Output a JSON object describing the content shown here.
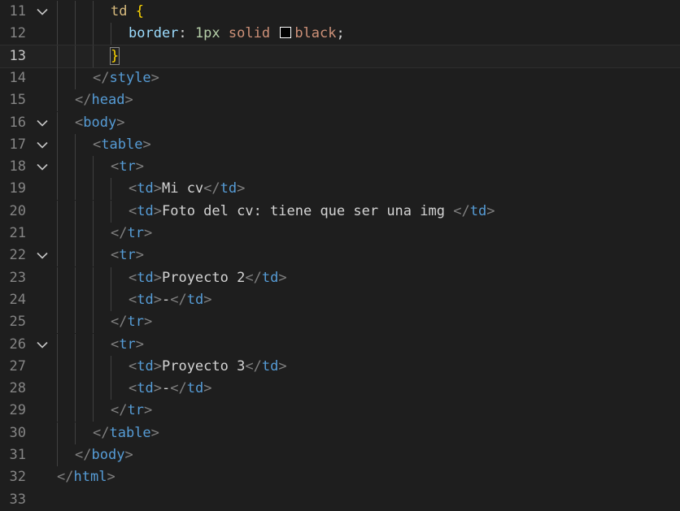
{
  "editor": {
    "language": "html",
    "active_line": 13,
    "lines": [
      {
        "n": "11",
        "fold": true,
        "indent": 3,
        "tokens": [
          [
            "sel",
            "td"
          ],
          [
            "text",
            " "
          ],
          [
            "brace",
            "{"
          ]
        ]
      },
      {
        "n": "12",
        "fold": false,
        "indent": 4,
        "tokens": [
          [
            "prop",
            "border"
          ],
          [
            "text",
            ": "
          ],
          [
            "num",
            "1px"
          ],
          [
            "text",
            " "
          ],
          [
            "val",
            "solid"
          ],
          [
            "text",
            " "
          ],
          [
            "swatch",
            ""
          ],
          [
            "val",
            "black"
          ],
          [
            "text",
            ";"
          ]
        ]
      },
      {
        "n": "13",
        "fold": false,
        "indent": 3,
        "tokens": [
          [
            "brace-hl",
            "}"
          ]
        ]
      },
      {
        "n": "14",
        "fold": false,
        "indent": 2,
        "tokens": [
          [
            "punct",
            "</"
          ],
          [
            "tag",
            "style"
          ],
          [
            "punct",
            ">"
          ]
        ]
      },
      {
        "n": "15",
        "fold": false,
        "indent": 1,
        "tokens": [
          [
            "punct",
            "</"
          ],
          [
            "tag",
            "head"
          ],
          [
            "punct",
            ">"
          ]
        ]
      },
      {
        "n": "16",
        "fold": true,
        "indent": 1,
        "tokens": [
          [
            "punct",
            "<"
          ],
          [
            "tag",
            "body"
          ],
          [
            "punct",
            ">"
          ]
        ]
      },
      {
        "n": "17",
        "fold": true,
        "indent": 2,
        "tokens": [
          [
            "punct",
            "<"
          ],
          [
            "tag",
            "table"
          ],
          [
            "punct",
            ">"
          ]
        ]
      },
      {
        "n": "18",
        "fold": true,
        "indent": 3,
        "tokens": [
          [
            "punct",
            "<"
          ],
          [
            "tag",
            "tr"
          ],
          [
            "punct",
            ">"
          ]
        ]
      },
      {
        "n": "19",
        "fold": false,
        "indent": 4,
        "tokens": [
          [
            "punct",
            "<"
          ],
          [
            "tag",
            "td"
          ],
          [
            "punct",
            ">"
          ],
          [
            "text",
            "Mi cv"
          ],
          [
            "punct",
            "</"
          ],
          [
            "tag",
            "td"
          ],
          [
            "punct",
            ">"
          ]
        ]
      },
      {
        "n": "20",
        "fold": false,
        "indent": 4,
        "tokens": [
          [
            "punct",
            "<"
          ],
          [
            "tag",
            "td"
          ],
          [
            "punct",
            ">"
          ],
          [
            "text",
            "Foto del cv: tiene que ser una img "
          ],
          [
            "punct",
            "</"
          ],
          [
            "tag",
            "td"
          ],
          [
            "punct",
            ">"
          ]
        ]
      },
      {
        "n": "21",
        "fold": false,
        "indent": 3,
        "tokens": [
          [
            "punct",
            "</"
          ],
          [
            "tag",
            "tr"
          ],
          [
            "punct",
            ">"
          ]
        ]
      },
      {
        "n": "22",
        "fold": true,
        "indent": 3,
        "tokens": [
          [
            "punct",
            "<"
          ],
          [
            "tag",
            "tr"
          ],
          [
            "punct",
            ">"
          ]
        ]
      },
      {
        "n": "23",
        "fold": false,
        "indent": 4,
        "tokens": [
          [
            "punct",
            "<"
          ],
          [
            "tag",
            "td"
          ],
          [
            "punct",
            ">"
          ],
          [
            "text",
            "Proyecto 2"
          ],
          [
            "punct",
            "</"
          ],
          [
            "tag",
            "td"
          ],
          [
            "punct",
            ">"
          ]
        ]
      },
      {
        "n": "24",
        "fold": false,
        "indent": 4,
        "tokens": [
          [
            "punct",
            "<"
          ],
          [
            "tag",
            "td"
          ],
          [
            "punct",
            ">"
          ],
          [
            "text",
            "-"
          ],
          [
            "punct",
            "</"
          ],
          [
            "tag",
            "td"
          ],
          [
            "punct",
            ">"
          ]
        ]
      },
      {
        "n": "25",
        "fold": false,
        "indent": 3,
        "tokens": [
          [
            "punct",
            "</"
          ],
          [
            "tag",
            "tr"
          ],
          [
            "punct",
            ">"
          ]
        ]
      },
      {
        "n": "26",
        "fold": true,
        "indent": 3,
        "tokens": [
          [
            "punct",
            "<"
          ],
          [
            "tag",
            "tr"
          ],
          [
            "punct",
            ">"
          ]
        ]
      },
      {
        "n": "27",
        "fold": false,
        "indent": 4,
        "tokens": [
          [
            "punct",
            "<"
          ],
          [
            "tag",
            "td"
          ],
          [
            "punct",
            ">"
          ],
          [
            "text",
            "Proyecto 3"
          ],
          [
            "punct",
            "</"
          ],
          [
            "tag",
            "td"
          ],
          [
            "punct",
            ">"
          ]
        ]
      },
      {
        "n": "28",
        "fold": false,
        "indent": 4,
        "tokens": [
          [
            "punct",
            "<"
          ],
          [
            "tag",
            "td"
          ],
          [
            "punct",
            ">"
          ],
          [
            "text",
            "-"
          ],
          [
            "punct",
            "</"
          ],
          [
            "tag",
            "td"
          ],
          [
            "punct",
            ">"
          ]
        ]
      },
      {
        "n": "29",
        "fold": false,
        "indent": 3,
        "tokens": [
          [
            "punct",
            "</"
          ],
          [
            "tag",
            "tr"
          ],
          [
            "punct",
            ">"
          ]
        ]
      },
      {
        "n": "30",
        "fold": false,
        "indent": 2,
        "tokens": [
          [
            "punct",
            "</"
          ],
          [
            "tag",
            "table"
          ],
          [
            "punct",
            ">"
          ]
        ]
      },
      {
        "n": "31",
        "fold": false,
        "indent": 1,
        "tokens": [
          [
            "punct",
            "</"
          ],
          [
            "tag",
            "body"
          ],
          [
            "punct",
            ">"
          ]
        ]
      },
      {
        "n": "32",
        "fold": false,
        "indent": 0,
        "tokens": [
          [
            "punct",
            "</"
          ],
          [
            "tag",
            "html"
          ],
          [
            "punct",
            ">"
          ]
        ]
      },
      {
        "n": "33",
        "fold": false,
        "indent": 0,
        "tokens": []
      }
    ]
  },
  "colors": {
    "background": "#1e1e1e",
    "tag": "#569cd6",
    "punctuation": "#808080",
    "text": "#d4d4d4",
    "selector": "#d7ba7d",
    "property": "#9cdcfe",
    "number": "#b5cea8",
    "value": "#ce9178",
    "bracket": "#ffd700"
  }
}
